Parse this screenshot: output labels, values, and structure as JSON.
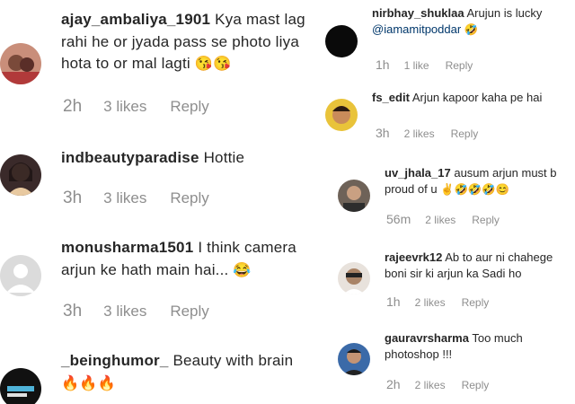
{
  "left": {
    "comments": [
      {
        "username": "ajay_ambaliya_1901",
        "text": "Kya mast lag rahi he or jyada pass se photo liya hota to or mal lagti",
        "emoji": "😘😘",
        "time": "2h",
        "likes": "3 likes",
        "reply": "Reply"
      },
      {
        "username": "indbeautyparadise",
        "text": "Hottie",
        "emoji": "",
        "time": "3h",
        "likes": "3 likes",
        "reply": "Reply"
      },
      {
        "username": "monusharma1501",
        "text": "I think camera arjun ke hath main hai...",
        "emoji": "😂",
        "time": "3h",
        "likes": "3 likes",
        "reply": "Reply"
      },
      {
        "username": "_beinghumor_",
        "text": "Beauty with brain",
        "emoji": "🔥🔥🔥",
        "time": "",
        "likes": "",
        "reply": ""
      }
    ]
  },
  "right": {
    "comments": [
      {
        "username": "nirbhay_shuklaa",
        "text": "Arujun is lucky",
        "mention": "@iamamitpoddar",
        "emoji": "🤣",
        "time": "1h",
        "likes": "1 like",
        "reply": "Reply"
      },
      {
        "username": "fs_edit",
        "text": "Arjun kapoor kaha pe hai",
        "emoji": "",
        "time": "3h",
        "likes": "2 likes",
        "reply": "Reply"
      },
      {
        "username": "uv_jhala_17",
        "text": "ausum arjun must b proud of u",
        "emoji": "✌🤣🤣🤣😊",
        "time": "56m",
        "likes": "2 likes",
        "reply": "Reply"
      },
      {
        "username": "rajeevrk12",
        "text": "Ab to aur ni chahege boni sir ki arjun ka Sadi ho",
        "emoji": "",
        "time": "1h",
        "likes": "2 likes",
        "reply": "Reply"
      },
      {
        "username": "gauravrsharma",
        "text": "Too much photoshop !!!",
        "emoji": "",
        "time": "2h",
        "likes": "2 likes",
        "reply": "Reply"
      }
    ]
  }
}
